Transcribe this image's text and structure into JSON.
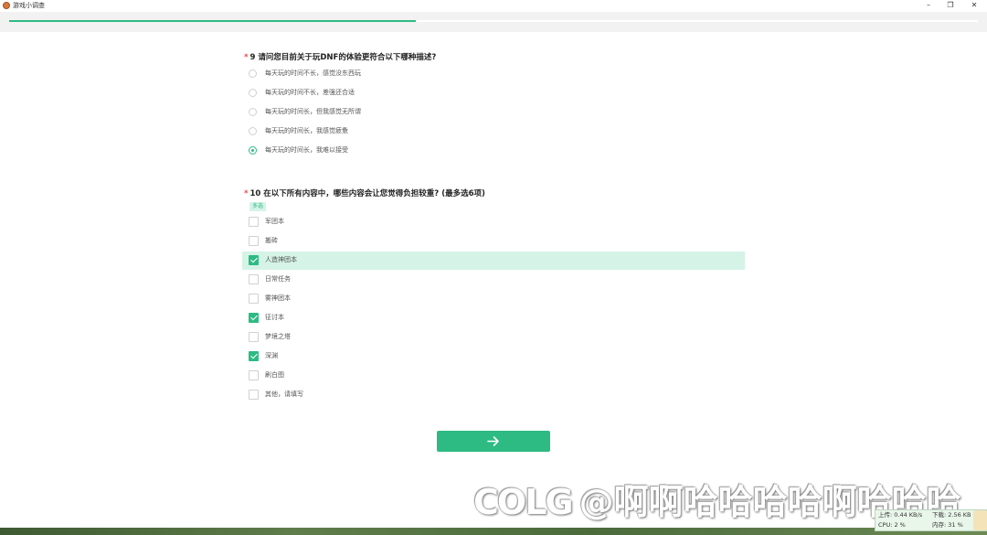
{
  "window": {
    "title": "游戏小调查"
  },
  "progress": {
    "fraction": 0.42
  },
  "q9": {
    "required_mark": "*",
    "number": "9",
    "title": "请问您目前关于玩DNF的体验更符合以下哪种描述?",
    "options": [
      {
        "label": "每天玩的时间不长，感觉没东西玩",
        "selected": false
      },
      {
        "label": "每天玩的时间不长，差强还合适",
        "selected": false
      },
      {
        "label": "每天玩的时间长，但我感觉无所谓",
        "selected": false
      },
      {
        "label": "每天玩的时间长，我感觉疲惫",
        "selected": false
      },
      {
        "label": "每天玩的时间长，我难以接受",
        "selected": true
      }
    ]
  },
  "q10": {
    "required_mark": "*",
    "number": "10",
    "title": "在以下所有内容中，哪些内容会让您觉得负担较重?  (最多选6项)",
    "tag": "多选",
    "options": [
      {
        "label": "军团本",
        "checked": false
      },
      {
        "label": "搬砖",
        "checked": false
      },
      {
        "label": "人造神团本",
        "checked": true
      },
      {
        "label": "日常任务",
        "checked": false
      },
      {
        "label": "雾神团本",
        "checked": false
      },
      {
        "label": "征讨本",
        "checked": true
      },
      {
        "label": "梦境之塔",
        "checked": false
      },
      {
        "label": "深渊",
        "checked": true
      },
      {
        "label": "刷白图",
        "checked": false
      },
      {
        "label": "其他，请填写",
        "checked": false
      }
    ]
  },
  "next_button": {
    "icon": "arrow-right-icon"
  },
  "watermark": {
    "logo": "COLG",
    "text": "@啊啊哈哈哈哈啊哈哈哈"
  },
  "net_monitor": {
    "upload": "上传: 0.44 KB/s",
    "download": "下载: 2.56 KB",
    "cpu": "CPU: 2 %",
    "memory": "内存: 31 %"
  },
  "colors": {
    "accent": "#2dbb83",
    "accent_light": "#d5f3e7",
    "required": "#e84a4a"
  }
}
